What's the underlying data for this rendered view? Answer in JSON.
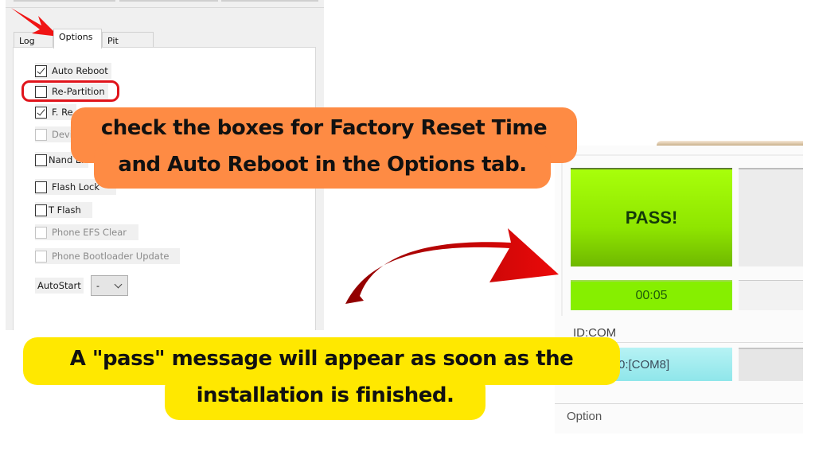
{
  "tabs": [
    {
      "label": "Log",
      "active": false
    },
    {
      "label": "Options",
      "active": true
    },
    {
      "label": "Pit",
      "active": false
    }
  ],
  "options": [
    {
      "label": "Auto Reboot",
      "checked": true,
      "enabled": true
    },
    {
      "label": "Re-Partition",
      "checked": false,
      "enabled": true
    },
    {
      "label": "F. Re",
      "checked": true,
      "enabled": true
    },
    {
      "label": "Devic",
      "checked": false,
      "enabled": false
    },
    {
      "label": "Nand Er",
      "checked": false,
      "enabled": true
    },
    {
      "label": "Flash Lock",
      "checked": false,
      "enabled": true
    },
    {
      "label": "T Flash",
      "checked": false,
      "enabled": true
    },
    {
      "label": "Phone EFS Clear",
      "checked": false,
      "enabled": false
    },
    {
      "label": "Phone Bootloader Update",
      "checked": false,
      "enabled": false
    }
  ],
  "autostart": {
    "label": "AutoStart",
    "value": "-"
  },
  "status": {
    "pass_label": "PASS!",
    "timer": "00:05",
    "id_com_label": "ID:COM",
    "com_port": "0:[COM8]",
    "option_label": "Option"
  },
  "colors": {
    "pass_green": "#8fe500",
    "orange_callout": "#fe8b44",
    "yellow_callout": "#ffe800",
    "arrow_red": "#e0141b"
  },
  "callouts": {
    "orange": [
      "check the boxes for Factory Reset Time",
      "and Auto Reboot in the Options tab."
    ],
    "yellow": [
      "A \"pass\" message will appear as soon as the",
      "installation is finished."
    ]
  },
  "icons": {
    "pointer_arrow": "red-pointer-arrow-icon",
    "curved_arrow": "red-curved-arrow-icon",
    "checkbox": "checkbox-icon",
    "dropdown": "chevron-down-icon"
  }
}
